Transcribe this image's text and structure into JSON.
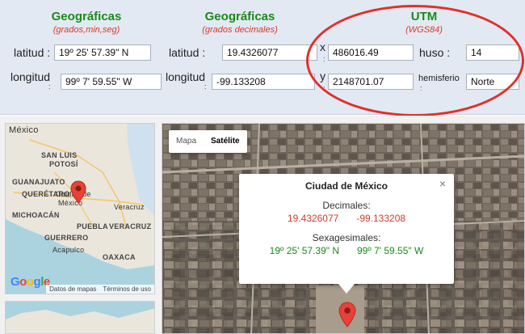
{
  "headers": {
    "geo": {
      "title": "Geográficas",
      "subtitle": "(grados,min,seg)"
    },
    "dec": {
      "title": "Geográficas",
      "subtitle": "(grados decimales)"
    },
    "utm": {
      "title": "UTM",
      "subtitle": "(WGS84)"
    }
  },
  "labels": {
    "latitud": "latitud :",
    "longitud": "longitud",
    "latitud_dec": "latitud :",
    "longitud_dec": "longitud",
    "x": "x",
    "y": "y",
    "huso": "huso :",
    "hemisferio": "hemisferio",
    "colon": ":"
  },
  "fields": {
    "lat_dms": "19º 25' 57.39\"  N",
    "lon_dms": "99º 7' 59.55\"  W",
    "lat_dec": "19.4326077",
    "lon_dec": "-99.133208",
    "utm_x": "486016.49",
    "utm_y": "2148701.07",
    "huso": "14",
    "hemisferio": "Norte"
  },
  "minimap": {
    "labels": [
      "México",
      "SAN LUIS",
      "POTOSÍ",
      "GUANAJUATO",
      "QUERÉTARO",
      "Ciudad de",
      "México",
      "MICHOACÁN",
      "Veracruz",
      "PUEBLA",
      "VERACRUZ",
      "GUERRERO",
      "Acapulco",
      "OAXACA"
    ],
    "attribution": "Datos de mapas",
    "terms": "Términos de uso",
    "logo": "Google"
  },
  "satellite": {
    "tab_map": "Mapa",
    "tab_sat": "Satélite",
    "bubble": {
      "title": "Ciudad de México",
      "dec_heading": "Decimales:",
      "dec_lat": "19.4326077",
      "dec_lon": "-99.133208",
      "sex_heading": "Sexagesimales:",
      "sex_lat": "19º 25' 57.39\"  N",
      "sex_lon": "99º 7' 59.55\"  W",
      "close": "×"
    }
  },
  "colors": {
    "accent_green": "#1a8a1a",
    "accent_red": "#d23a2a",
    "panel_bg": "#e3e9f3"
  }
}
